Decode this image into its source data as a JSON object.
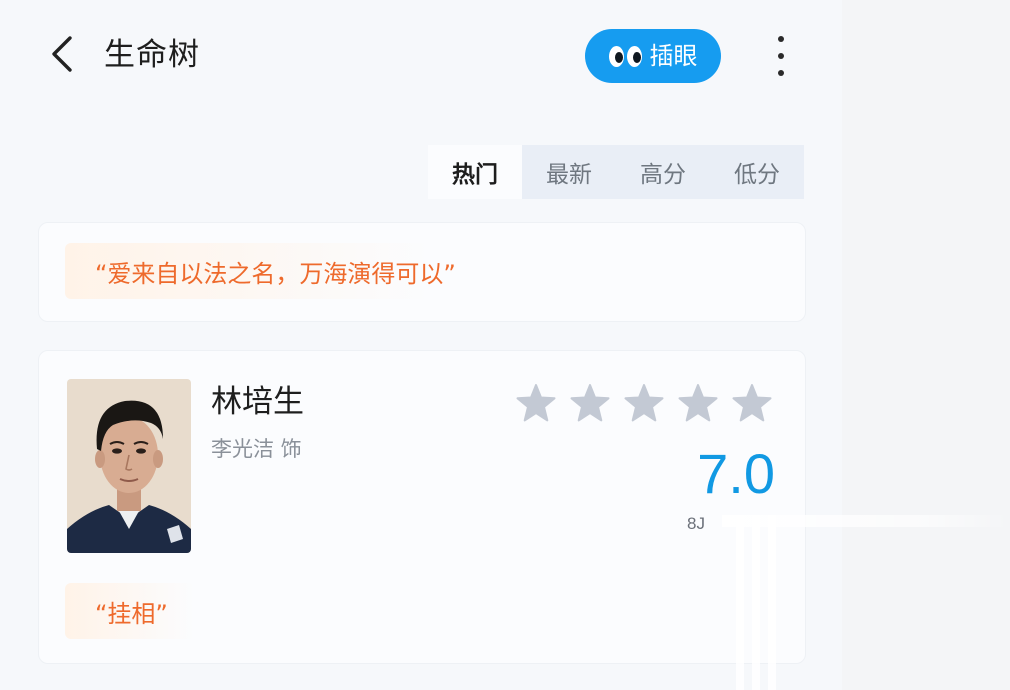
{
  "header": {
    "back_icon": "chevron-left-icon",
    "title": "生命树",
    "watch_button": {
      "icon": "eyes-icon",
      "label": "插眼",
      "color": "#169cf0"
    },
    "more_icon": "more-vertical-icon"
  },
  "tabs": [
    {
      "label": "热门",
      "active": true
    },
    {
      "label": "最新",
      "active": false
    },
    {
      "label": "高分",
      "active": false
    },
    {
      "label": "低分",
      "active": false
    }
  ],
  "quote_card": {
    "text": "“爱来自以法之名，万海演得可以”",
    "color": "#ee6a2c"
  },
  "character_card": {
    "photo": "actor-portrait",
    "name": "林培生",
    "actor": "李光洁 饰",
    "rating": {
      "stars_total": 5,
      "stars_filled": 0,
      "star_color": "#c3c9d4",
      "score": "7.0",
      "score_color": "#1199e3",
      "count": "8J"
    },
    "tag": "“挂相”"
  },
  "colors": {
    "background": "#f6f8fb",
    "card": "#fbfcfe",
    "accent_orange": "#ee6a2c",
    "accent_blue": "#169cf0"
  }
}
